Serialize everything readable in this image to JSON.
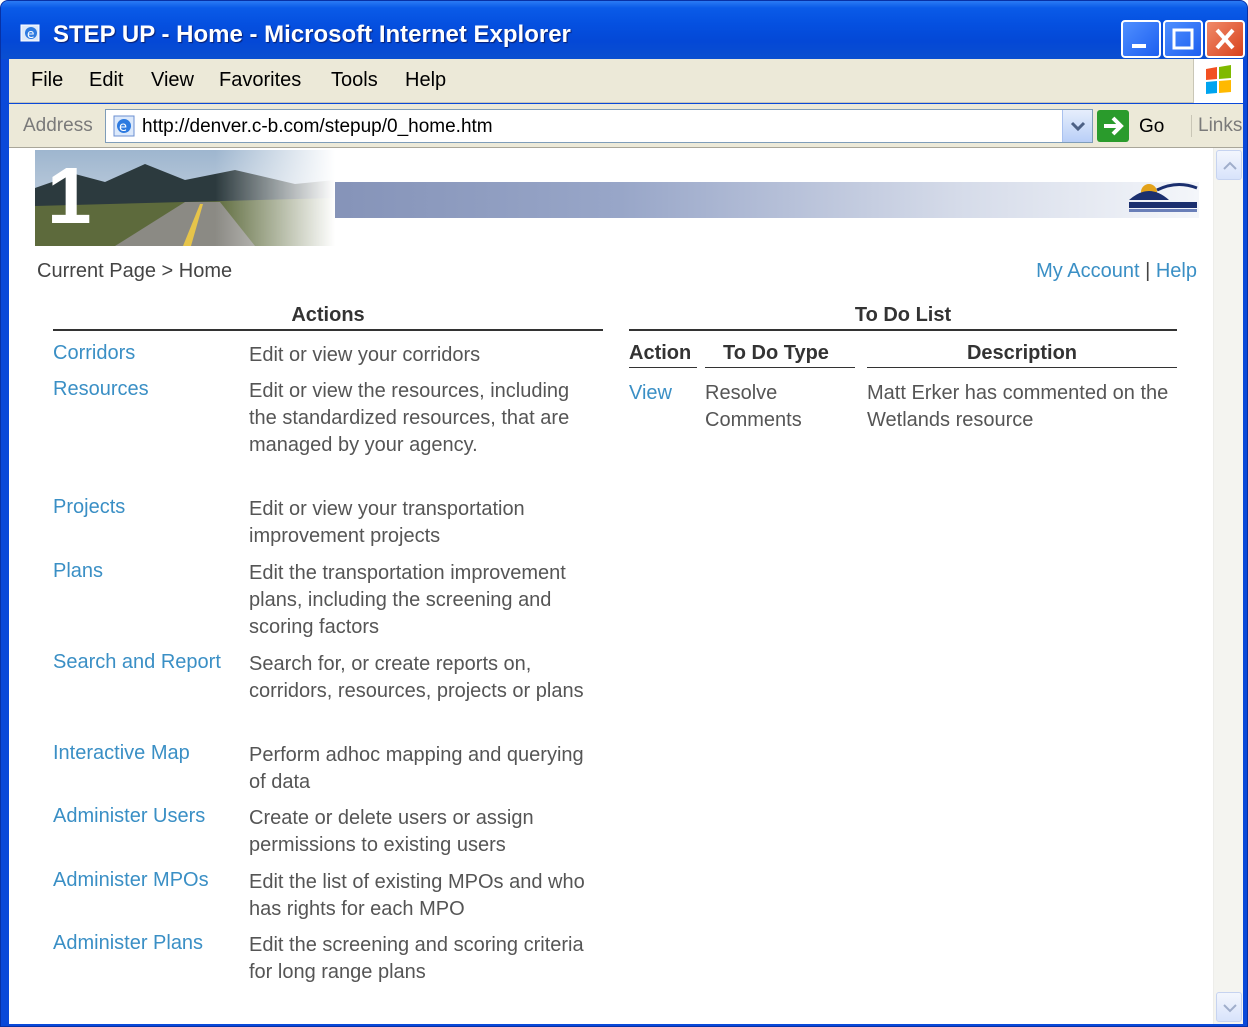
{
  "window": {
    "title": "STEP UP - Home - Microsoft Internet Explorer"
  },
  "menubar": {
    "items": [
      "File",
      "Edit",
      "View",
      "Favorites",
      "Tools",
      "Help"
    ]
  },
  "addressbar": {
    "label": "Address",
    "url": "http://denver.c-b.com/stepup/0_home.htm",
    "go_label": "Go",
    "links_label": "Links"
  },
  "banner": {
    "number": "1"
  },
  "breadcrumb": {
    "text": "Current Page > Home"
  },
  "toplinks": {
    "my_account": "My Account",
    "separator": "|",
    "help": "Help"
  },
  "actions": {
    "title": "Actions",
    "rows": [
      {
        "label": "Corridors",
        "desc": "Edit or view your corridors"
      },
      {
        "label": "Resources",
        "desc": "Edit or view the resources, including the standardized resources, that are managed by your agency."
      },
      {
        "label": "Projects",
        "desc": "Edit or view your transportation improvement projects"
      },
      {
        "label": "Plans",
        "desc": "Edit the transportation improvement plans, including the screening and scoring factors"
      },
      {
        "label": "Search and Report",
        "desc": "Search for, or create reports on, corridors, resources, projects or plans"
      },
      {
        "label": "Interactive Map",
        "desc": "Perform adhoc mapping and querying of data"
      },
      {
        "label": "Administer Users",
        "desc": "Create or delete users or assign permissions to existing users"
      },
      {
        "label": "Administer MPOs",
        "desc": "Edit the list of existing MPOs and who has rights for each MPO"
      },
      {
        "label": "Administer Plans",
        "desc": "Edit the screening and scoring criteria for long range plans"
      }
    ]
  },
  "todo": {
    "title": "To Do List",
    "headers": {
      "action": "Action",
      "type": "To Do Type",
      "description": "Description"
    },
    "rows": [
      {
        "action": "View",
        "type": "Resolve Comments",
        "description": "Matt Erker has commented on the Wetlands resource"
      }
    ]
  },
  "colors": {
    "link": "#3a8fc5",
    "titlebar": "#0550e0",
    "chrome": "#ece9d8"
  }
}
